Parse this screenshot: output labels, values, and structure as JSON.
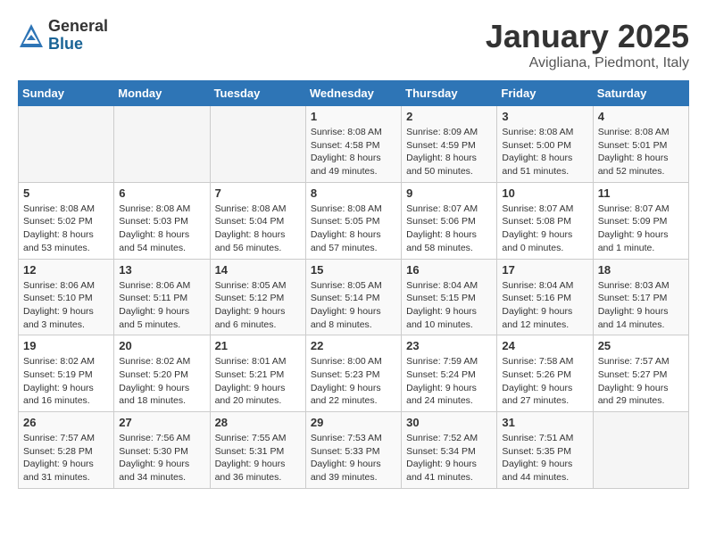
{
  "header": {
    "logo_general": "General",
    "logo_blue": "Blue",
    "title": "January 2025",
    "location": "Avigliana, Piedmont, Italy"
  },
  "weekdays": [
    "Sunday",
    "Monday",
    "Tuesday",
    "Wednesday",
    "Thursday",
    "Friday",
    "Saturday"
  ],
  "weeks": [
    [
      {
        "day": "",
        "info": ""
      },
      {
        "day": "",
        "info": ""
      },
      {
        "day": "",
        "info": ""
      },
      {
        "day": "1",
        "info": "Sunrise: 8:08 AM\nSunset: 4:58 PM\nDaylight: 8 hours\nand 49 minutes."
      },
      {
        "day": "2",
        "info": "Sunrise: 8:09 AM\nSunset: 4:59 PM\nDaylight: 8 hours\nand 50 minutes."
      },
      {
        "day": "3",
        "info": "Sunrise: 8:08 AM\nSunset: 5:00 PM\nDaylight: 8 hours\nand 51 minutes."
      },
      {
        "day": "4",
        "info": "Sunrise: 8:08 AM\nSunset: 5:01 PM\nDaylight: 8 hours\nand 52 minutes."
      }
    ],
    [
      {
        "day": "5",
        "info": "Sunrise: 8:08 AM\nSunset: 5:02 PM\nDaylight: 8 hours\nand 53 minutes."
      },
      {
        "day": "6",
        "info": "Sunrise: 8:08 AM\nSunset: 5:03 PM\nDaylight: 8 hours\nand 54 minutes."
      },
      {
        "day": "7",
        "info": "Sunrise: 8:08 AM\nSunset: 5:04 PM\nDaylight: 8 hours\nand 56 minutes."
      },
      {
        "day": "8",
        "info": "Sunrise: 8:08 AM\nSunset: 5:05 PM\nDaylight: 8 hours\nand 57 minutes."
      },
      {
        "day": "9",
        "info": "Sunrise: 8:07 AM\nSunset: 5:06 PM\nDaylight: 8 hours\nand 58 minutes."
      },
      {
        "day": "10",
        "info": "Sunrise: 8:07 AM\nSunset: 5:08 PM\nDaylight: 9 hours\nand 0 minutes."
      },
      {
        "day": "11",
        "info": "Sunrise: 8:07 AM\nSunset: 5:09 PM\nDaylight: 9 hours\nand 1 minute."
      }
    ],
    [
      {
        "day": "12",
        "info": "Sunrise: 8:06 AM\nSunset: 5:10 PM\nDaylight: 9 hours\nand 3 minutes."
      },
      {
        "day": "13",
        "info": "Sunrise: 8:06 AM\nSunset: 5:11 PM\nDaylight: 9 hours\nand 5 minutes."
      },
      {
        "day": "14",
        "info": "Sunrise: 8:05 AM\nSunset: 5:12 PM\nDaylight: 9 hours\nand 6 minutes."
      },
      {
        "day": "15",
        "info": "Sunrise: 8:05 AM\nSunset: 5:14 PM\nDaylight: 9 hours\nand 8 minutes."
      },
      {
        "day": "16",
        "info": "Sunrise: 8:04 AM\nSunset: 5:15 PM\nDaylight: 9 hours\nand 10 minutes."
      },
      {
        "day": "17",
        "info": "Sunrise: 8:04 AM\nSunset: 5:16 PM\nDaylight: 9 hours\nand 12 minutes."
      },
      {
        "day": "18",
        "info": "Sunrise: 8:03 AM\nSunset: 5:17 PM\nDaylight: 9 hours\nand 14 minutes."
      }
    ],
    [
      {
        "day": "19",
        "info": "Sunrise: 8:02 AM\nSunset: 5:19 PM\nDaylight: 9 hours\nand 16 minutes."
      },
      {
        "day": "20",
        "info": "Sunrise: 8:02 AM\nSunset: 5:20 PM\nDaylight: 9 hours\nand 18 minutes."
      },
      {
        "day": "21",
        "info": "Sunrise: 8:01 AM\nSunset: 5:21 PM\nDaylight: 9 hours\nand 20 minutes."
      },
      {
        "day": "22",
        "info": "Sunrise: 8:00 AM\nSunset: 5:23 PM\nDaylight: 9 hours\nand 22 minutes."
      },
      {
        "day": "23",
        "info": "Sunrise: 7:59 AM\nSunset: 5:24 PM\nDaylight: 9 hours\nand 24 minutes."
      },
      {
        "day": "24",
        "info": "Sunrise: 7:58 AM\nSunset: 5:26 PM\nDaylight: 9 hours\nand 27 minutes."
      },
      {
        "day": "25",
        "info": "Sunrise: 7:57 AM\nSunset: 5:27 PM\nDaylight: 9 hours\nand 29 minutes."
      }
    ],
    [
      {
        "day": "26",
        "info": "Sunrise: 7:57 AM\nSunset: 5:28 PM\nDaylight: 9 hours\nand 31 minutes."
      },
      {
        "day": "27",
        "info": "Sunrise: 7:56 AM\nSunset: 5:30 PM\nDaylight: 9 hours\nand 34 minutes."
      },
      {
        "day": "28",
        "info": "Sunrise: 7:55 AM\nSunset: 5:31 PM\nDaylight: 9 hours\nand 36 minutes."
      },
      {
        "day": "29",
        "info": "Sunrise: 7:53 AM\nSunset: 5:33 PM\nDaylight: 9 hours\nand 39 minutes."
      },
      {
        "day": "30",
        "info": "Sunrise: 7:52 AM\nSunset: 5:34 PM\nDaylight: 9 hours\nand 41 minutes."
      },
      {
        "day": "31",
        "info": "Sunrise: 7:51 AM\nSunset: 5:35 PM\nDaylight: 9 hours\nand 44 minutes."
      },
      {
        "day": "",
        "info": ""
      }
    ]
  ]
}
